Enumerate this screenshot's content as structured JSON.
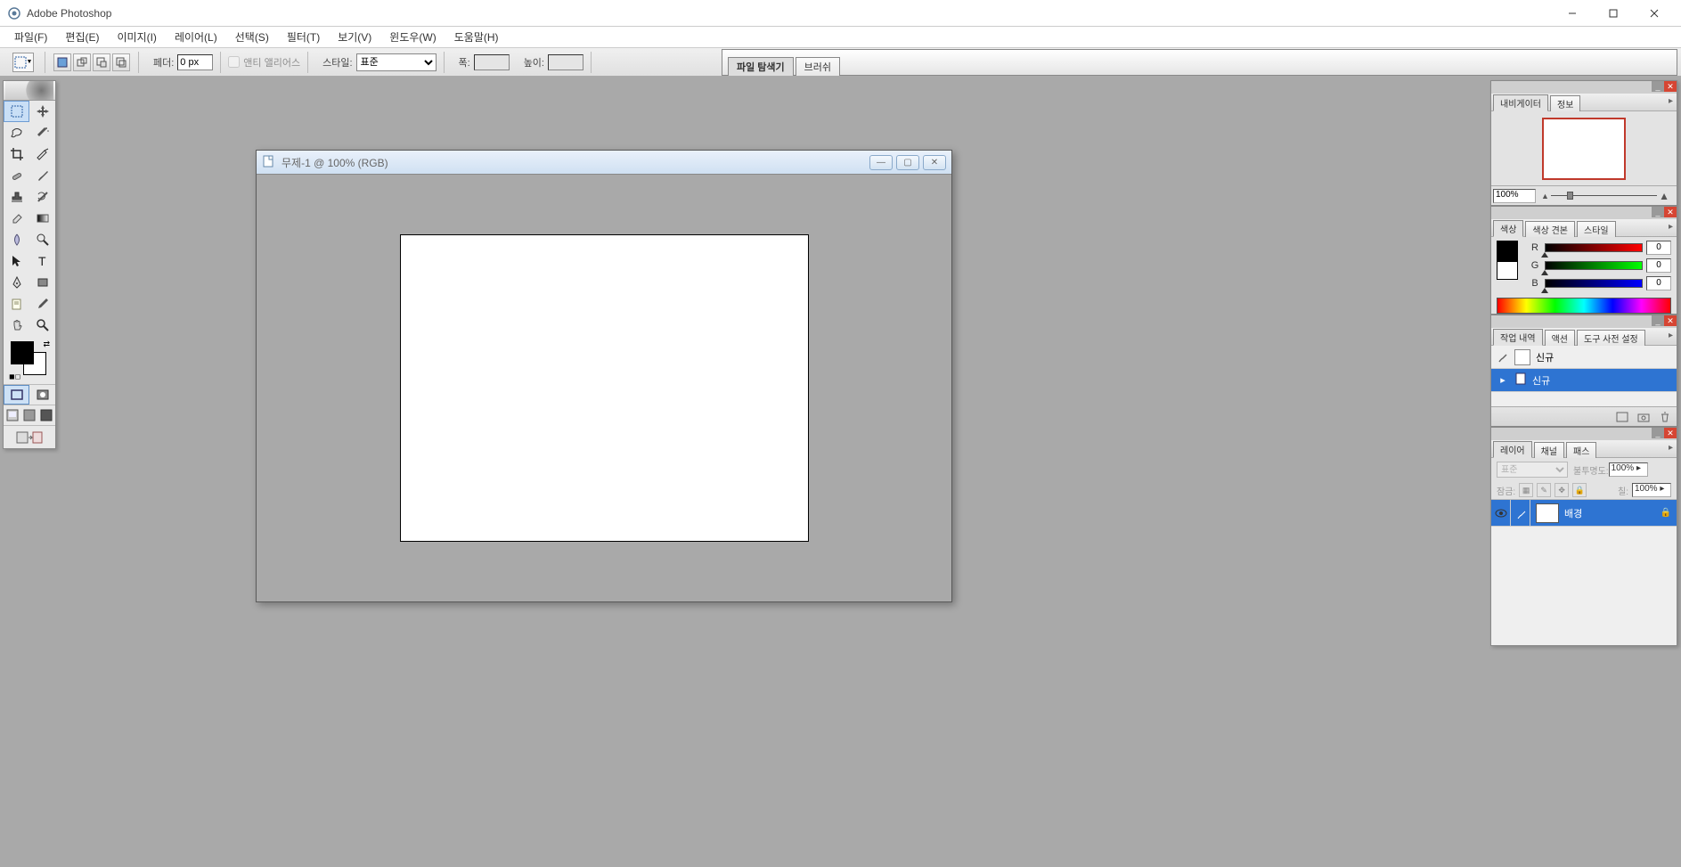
{
  "app": {
    "title": "Adobe Photoshop"
  },
  "menu": {
    "file": "파일(F)",
    "edit": "편집(E)",
    "image": "이미지(I)",
    "layer": "레이어(L)",
    "select": "선택(S)",
    "filter": "필터(T)",
    "view": "보기(V)",
    "window": "윈도우(W)",
    "help": "도움말(H)"
  },
  "options": {
    "feather_label": "페더:",
    "feather_value": "0 px",
    "antialias_label": "앤티 앨리어스",
    "style_label": "스타일:",
    "style_value": "표준",
    "width_label": "폭:",
    "width_value": "",
    "height_label": "높이:",
    "height_value": ""
  },
  "dockstrip": {
    "tab1": "파일 탐색기",
    "tab2": "브러쉬"
  },
  "document": {
    "title": "무제-1 @ 100% (RGB)"
  },
  "navigator": {
    "tab_nav": "내비게이터",
    "tab_info": "정보",
    "zoom": "100%"
  },
  "color": {
    "tab_color": "색상",
    "tab_swatch": "색상 견본",
    "tab_style": "스타일",
    "r_label": "R",
    "r_val": "0",
    "g_label": "G",
    "g_val": "0",
    "b_label": "B",
    "b_val": "0"
  },
  "history": {
    "tab_history": "작업 내역",
    "tab_actions": "액션",
    "tab_presets": "도구 사전 설정",
    "item_snapshot": "신규",
    "item_step": "신규"
  },
  "layers": {
    "tab_layers": "레이어",
    "tab_channels": "채널",
    "tab_paths": "패스",
    "blend_mode": "표준",
    "opacity_label": "불투명도:",
    "opacity_val": "100% ▸",
    "lock_label": "잠금:",
    "fill_label": "칠:",
    "fill_val": "100% ▸",
    "layer_bg": "배경"
  }
}
